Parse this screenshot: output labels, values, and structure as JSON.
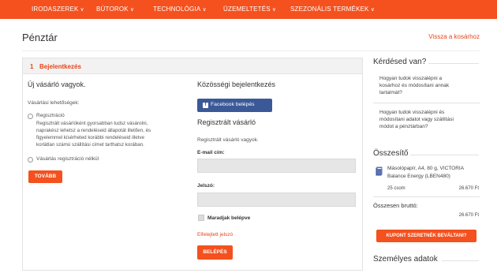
{
  "nav": {
    "items": [
      {
        "label": "IRODASZEREK"
      },
      {
        "label": "BÚTOROK"
      },
      {
        "label": "TECHNOLÓGIA"
      },
      {
        "label": "ÜZEMELTETÉS"
      },
      {
        "label": "SZEZONÁLIS TERMÉKEK"
      }
    ],
    "chevron": "∨"
  },
  "page": {
    "title": "Pénztár",
    "back_link": "Vissza a kosárhoz"
  },
  "step": {
    "number": "1",
    "label": "Bejelentkezés"
  },
  "new_buyer": {
    "heading": "Új vásárló vagyok.",
    "options_label": "Vásárlási lehetőségek:",
    "registration_label": "Regisztráció",
    "registration_desc": [
      "Regisztrált vásárlóként gyorsabban tudsz vásárolni,",
      "naprakész lehetsz a rendeléseid állapotát illetően, és",
      "figyelemmel kísérheted korábbi rendeléseid illetve",
      "korlátlan számú szállítási címet tarthatsz korában."
    ],
    "guest_label": "Vásárlás regisztráció nélkül",
    "continue_button": "TOVÁBB"
  },
  "social": {
    "heading": "Közösségi bejelentkezés",
    "facebook_button": "Facebook belépés"
  },
  "registered": {
    "heading": "Regisztrált vásárló",
    "subtitle": "Regisztrált vásárló vagyok.",
    "email_label": "E-mail cím:",
    "email_value": "",
    "password_label": "Jelszó:",
    "password_value": "",
    "remember_label": "Maradjak belépve",
    "forgot_link": "Elfelejtett jelszó",
    "login_button": "BELÉPÉS"
  },
  "sidebar": {
    "questions_heading": "Kérdésed van?",
    "questions": [
      [
        "Hogyan tudok visszalépni a",
        "kosárhoz és módosítani annak",
        "tartalmát?"
      ],
      [
        "Hogyan tudok visszalépni és",
        "módosítani adatot vagy szállítási",
        "módot a pénztárban?"
      ]
    ],
    "summary_heading": "Összesítő",
    "product": {
      "name_lines": [
        "Másolópapír, A4, 80 g, VICTORIA",
        "Balance Energy (LBEN480)"
      ],
      "qty": "25 csom",
      "price": "26.670 Ft"
    },
    "total_label": "Összesen bruttó:",
    "total_value": "26.670 Ft",
    "coupon_button": "KUPONT SZERETNÉK BEVÁLTANI?",
    "personal_heading": "Személyes adatok"
  },
  "colors": {
    "accent": "#f4511e",
    "link": "#e8461a",
    "facebook": "#3b5998"
  }
}
